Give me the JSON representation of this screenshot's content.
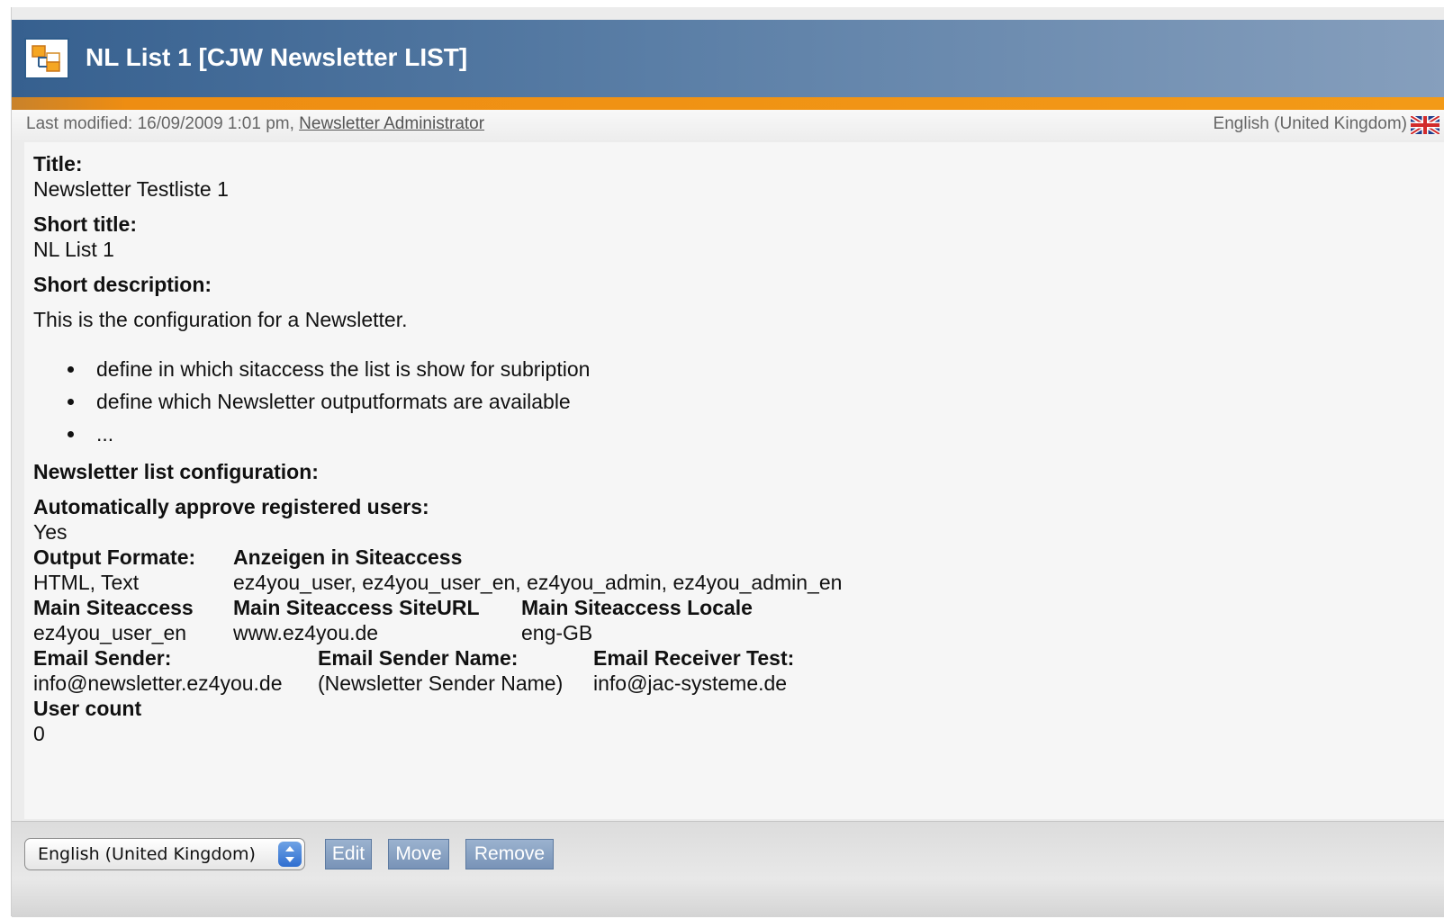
{
  "window": {
    "title": "NL List 1 [CJW Newsletter LIST]",
    "icon": "class-list-icon"
  },
  "meta": {
    "last_modified_prefix": "Last modified: 16/09/2009 1:01 pm,",
    "author": "Newsletter Administrator",
    "language": "English (United Kingdom)",
    "flag_icon": "uk-flag-icon"
  },
  "fields": {
    "title_label": "Title:",
    "title_value": "Newsletter Testliste 1",
    "short_title_label": "Short title:",
    "short_title_value": "NL List 1",
    "short_description_label": "Short description:",
    "short_description_text": "This is the configuration for a Newsletter.",
    "short_description_items": [
      "define in which sitaccess the list is show for subription",
      "define which Newsletter outputformats are available",
      "..."
    ],
    "config_label": "Newsletter list configuration:",
    "auto_approve_label": "Automatically approve registered users:",
    "auto_approve_value": "Yes",
    "output_formats_label": "Output Formate:",
    "output_formats_value": "HTML, Text",
    "siteaccess_label": "Anzeigen in Siteaccess",
    "siteaccess_value": "ez4you_user, ez4you_user_en, ez4you_admin, ez4you_admin_en",
    "main_siteaccess_label": "Main Siteaccess",
    "main_siteaccess_value": "ez4you_user_en",
    "main_siteurl_label": "Main Siteaccess SiteURL",
    "main_siteurl_value": "www.ez4you.de",
    "main_locale_label": "Main Siteaccess Locale",
    "main_locale_value": "eng-GB",
    "email_sender_label": "Email Sender:",
    "email_sender_value": "info@newsletter.ez4you.de",
    "email_sender_name_label": "Email Sender Name:",
    "email_sender_name_value": "(Newsletter Sender Name)",
    "email_receiver_test_label": "Email Receiver Test:",
    "email_receiver_test_value": "info@jac-systeme.de",
    "user_count_label": "User count",
    "user_count_value": "0"
  },
  "controls": {
    "language_select_value": "English (United Kingdom)",
    "edit_label": "Edit",
    "move_label": "Move",
    "remove_label": "Remove"
  },
  "colors": {
    "title_bar": "#36608f",
    "accent_orange": "#ee8d12",
    "button_blue": "#8aa4c5"
  }
}
